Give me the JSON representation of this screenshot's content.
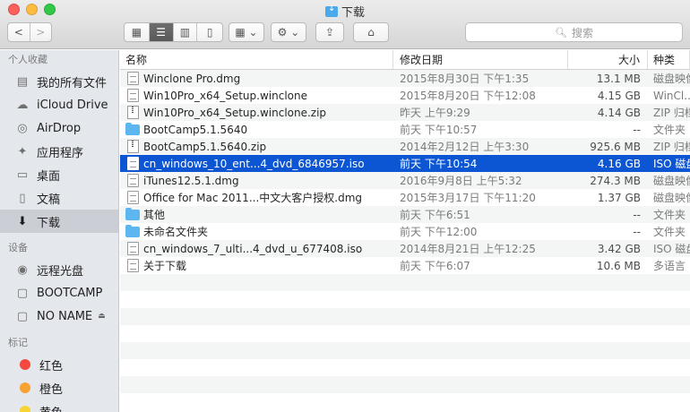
{
  "window": {
    "title": "下载"
  },
  "toolbar": {
    "back": "<",
    "forward": ">",
    "view_icon": "▦",
    "view_list": "☰",
    "view_column": "▥",
    "view_coverflow": "▯",
    "arrange": "▦ ⌄",
    "action": "⚙ ⌄",
    "share": "⇪",
    "tag": "⌂"
  },
  "search": {
    "placeholder": "搜索"
  },
  "sidebar": {
    "favorites_header": "个人收藏",
    "favorites": [
      {
        "label": "我的所有文件",
        "icon": "all-files-icon"
      },
      {
        "label": "iCloud Drive",
        "icon": "cloud-icon"
      },
      {
        "label": "AirDrop",
        "icon": "airdrop-icon"
      },
      {
        "label": "应用程序",
        "icon": "applications-icon"
      },
      {
        "label": "桌面",
        "icon": "desktop-icon"
      },
      {
        "label": "文稿",
        "icon": "documents-icon"
      },
      {
        "label": "下载",
        "icon": "downloads-icon"
      }
    ],
    "devices_header": "设备",
    "devices": [
      {
        "label": "远程光盘",
        "icon": "remote-disc-icon"
      },
      {
        "label": "BOOTCAMP",
        "icon": "disk-icon"
      },
      {
        "label": "NO NAME",
        "icon": "disk-icon"
      }
    ],
    "tags_header": "标记",
    "tags": [
      {
        "label": "红色",
        "color": "#f3493f"
      },
      {
        "label": "橙色",
        "color": "#f7a233"
      },
      {
        "label": "黄色",
        "color": "#f7d432"
      }
    ]
  },
  "columns": {
    "name": "名称",
    "date": "修改日期",
    "size": "大小",
    "kind": "种类"
  },
  "files": [
    {
      "name": "Winclone Pro.dmg",
      "date": "2015年8月30日 下午1:35",
      "size": "13.1 MB",
      "kind": "磁盘映像",
      "icon": "doc"
    },
    {
      "name": "Win10Pro_x64_Setup.winclone",
      "date": "2015年8月20日 下午12:08",
      "size": "4.15 GB",
      "kind": "WinCl...d",
      "icon": "doc"
    },
    {
      "name": "Win10Pro_x64_Setup.winclone.zip",
      "date": "昨天 上午9:29",
      "size": "4.14 GB",
      "kind": "ZIP 归档",
      "icon": "zip"
    },
    {
      "name": "BootCamp5.1.5640",
      "date": "前天 下午10:57",
      "size": "--",
      "kind": "文件夹",
      "icon": "folder"
    },
    {
      "name": "BootCamp5.1.5640.zip",
      "date": "2014年2月12日 上午3:30",
      "size": "925.6 MB",
      "kind": "ZIP 归档",
      "icon": "zip"
    },
    {
      "name": "cn_windows_10_ent...4_dvd_6846957.iso",
      "date": "前天 下午10:54",
      "size": "4.16 GB",
      "kind": "ISO 磁盘",
      "icon": "doc"
    },
    {
      "name": "iTunes12.5.1.dmg",
      "date": "2016年9月8日 上午5:32",
      "size": "274.3 MB",
      "kind": "磁盘映像",
      "icon": "doc"
    },
    {
      "name": "Office for Mac 2011...中文大客户授权.dmg",
      "date": "2015年3月17日 下午11:20",
      "size": "1.37 GB",
      "kind": "磁盘映像",
      "icon": "doc"
    },
    {
      "name": "其他",
      "date": "前天 下午6:51",
      "size": "--",
      "kind": "文件夹",
      "icon": "folder"
    },
    {
      "name": "未命名文件夹",
      "date": "前天 下午12:00",
      "size": "--",
      "kind": "文件夹",
      "icon": "folder"
    },
    {
      "name": "cn_windows_7_ulti...4_dvd_u_677408.iso",
      "date": "2014年8月21日 上午12:25",
      "size": "3.42 GB",
      "kind": "ISO 磁盘",
      "icon": "doc"
    },
    {
      "name": "关于下载",
      "date": "前天 下午6:07",
      "size": "10.6 MB",
      "kind": "多语言 P",
      "icon": "doc"
    }
  ],
  "selected_file": "cn_windows_10_ent...4_dvd_6846957.iso"
}
